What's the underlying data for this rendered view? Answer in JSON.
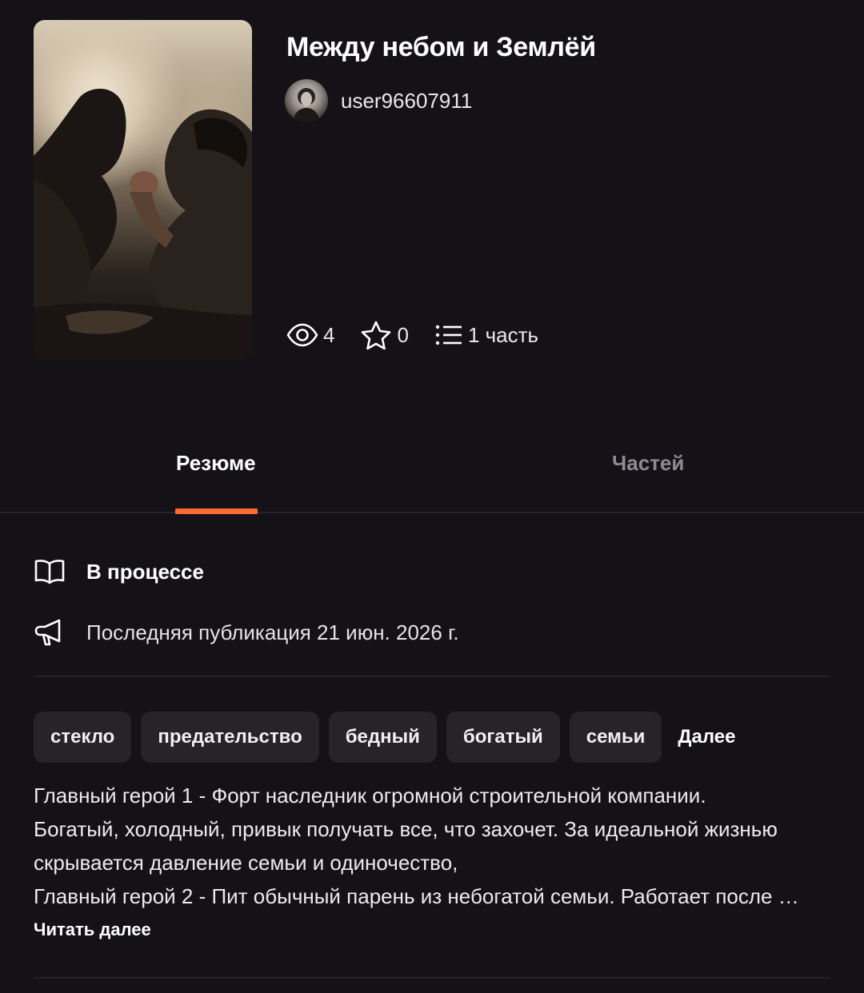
{
  "story": {
    "title": "Между небом и Землёй",
    "author": "user96607911",
    "views": "4",
    "stars": "0",
    "parts": "1 часть"
  },
  "tabs": {
    "summary": "Резюме",
    "parts": "Частей"
  },
  "info": {
    "status": "В процессе",
    "last_published": "Последняя публикация 21 июн. 2026 г."
  },
  "tags": [
    "стекло",
    "предательство",
    "бедный",
    "богатый",
    "семьи"
  ],
  "tags_more": "Далее",
  "summary_lines": [
    "Главный герой 1 - Форт наследник огромной строительной компании.",
    "Богатый, холодный, привык получать все, что захочет. За идеальной жизнью",
    "скрывается давление семьи и одиночество,",
    "Главный герой 2 - Пит обычный парень из небогатой семьи. Работает после …"
  ],
  "read_more": "Читать далее",
  "colors": {
    "background": "#141216",
    "accent": "#ff6a33",
    "tag_bg": "#262329",
    "inactive_tab": "#8d8a91"
  },
  "icons": {
    "views": "eye-icon",
    "stars": "star-icon",
    "parts": "list-icon",
    "status": "open-book-icon",
    "publication": "megaphone-icon"
  }
}
